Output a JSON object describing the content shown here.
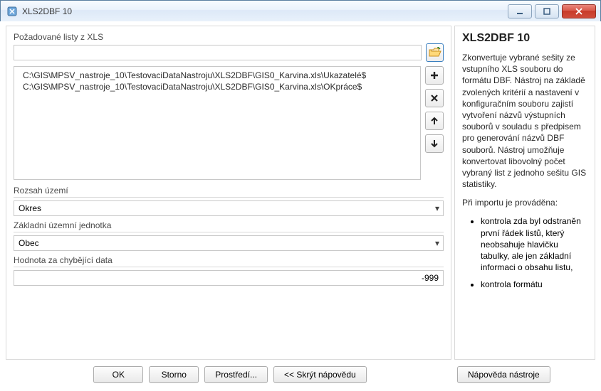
{
  "window": {
    "title": "XLS2DBF 10"
  },
  "left": {
    "sheets_label": "Požadované listy z XLS",
    "path_value": "",
    "list_items": [
      "C:\\GIS\\MPSV_nastroje_10\\TestovaciDataNastroju\\XLS2DBF\\GIS0_Karvina.xls\\Ukazatelé$",
      "C:\\GIS\\MPSV_nastroje_10\\TestovaciDataNastroju\\XLS2DBF\\GIS0_Karvina.xls\\OKpráce$"
    ],
    "scope_label": "Rozsah území",
    "scope_value": "Okres",
    "unit_label": "Základní územní jednotka",
    "unit_value": "Obec",
    "missing_label": "Hodnota za chybějící data",
    "missing_value": "-999"
  },
  "help": {
    "title": "XLS2DBF 10",
    "para1": "Zkonvertuje vybrané sešity ze vstupního XLS souboru do formátu DBF. Nástroj na základě zvolených kritérií a nastavení v konfiguračním souboru zajistí vytvoření názvů výstupních souborů v souladu s předpisem pro generování názvů DBF souborů. Nástroj umožňuje konvertovat libovolný počet vybraný list z jednoho sešitu GIS statistiky.",
    "para2": "Při importu je prováděna:",
    "bullet1": "kontrola zda byl odstraněn první řádek listů, který neobsahuje hlavičku tabulky, ale jen základní informaci o obsahu listu,",
    "bullet2": "kontrola formátu"
  },
  "buttons": {
    "ok": "OK",
    "cancel": "Storno",
    "env": "Prostředí...",
    "hide_help": "<< Skrýt nápovědu",
    "tool_help": "Nápověda nástroje"
  }
}
